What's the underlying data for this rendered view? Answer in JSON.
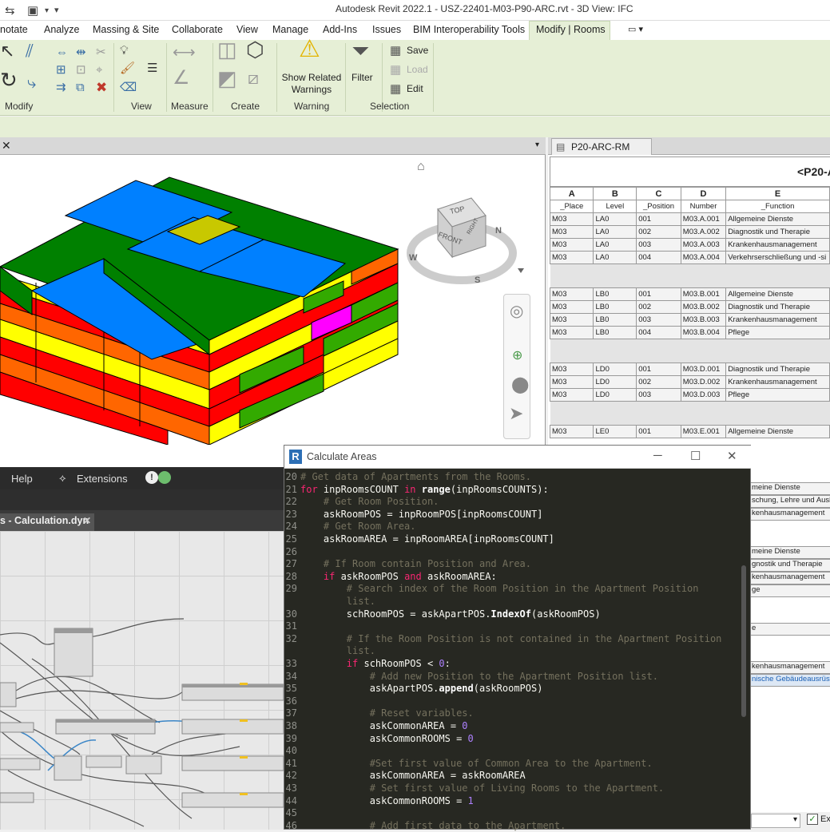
{
  "window": {
    "title": "Autodesk Revit 2022.1 - USZ-22401-M03-P90-ARC.rvt - 3D View: IFC"
  },
  "ribbon_tabs": [
    {
      "label": "notate"
    },
    {
      "label": "Analyze"
    },
    {
      "label": "Massing & Site"
    },
    {
      "label": "Collaborate"
    },
    {
      "label": "View"
    },
    {
      "label": "Manage"
    },
    {
      "label": "Add-Ins"
    },
    {
      "label": "Issues"
    },
    {
      "label": "BIM Interoperability Tools"
    },
    {
      "label": "Modify | Rooms"
    }
  ],
  "ribbon": {
    "panels": {
      "modify": "Modify",
      "view": "View",
      "measure": "Measure",
      "create": "Create",
      "warning": "Warning",
      "selection": "Selection"
    },
    "show_related_warnings": "Show Related\nWarnings",
    "filter": "Filter",
    "save": "Save",
    "load": "Load",
    "edit": "Edit"
  },
  "viewcube": {
    "top": "TOP",
    "front": "FRONT",
    "right": "RIGHT",
    "compass_w": "W",
    "compass_s": "S",
    "compass_n": "N"
  },
  "schedule": {
    "tab_label": "P20-ARC-RM",
    "title": "<P20-A",
    "columns": [
      "A",
      "B",
      "C",
      "D",
      "E"
    ],
    "subheaders": [
      "_Place",
      "Level",
      "_Position",
      "Number",
      "_Function"
    ],
    "groups": [
      [
        [
          "M03",
          "LA0",
          "001",
          "M03.A.001",
          "Allgemeine Dienste"
        ],
        [
          "M03",
          "LA0",
          "002",
          "M03.A.002",
          "Diagnostik und Therapie"
        ],
        [
          "M03",
          "LA0",
          "003",
          "M03.A.003",
          "Krankenhausmanagement"
        ],
        [
          "M03",
          "LA0",
          "004",
          "M03.A.004",
          "Verkehrserschließung und -si"
        ]
      ],
      [
        [
          "M03",
          "LB0",
          "001",
          "M03.B.001",
          "Allgemeine Dienste"
        ],
        [
          "M03",
          "LB0",
          "002",
          "M03.B.002",
          "Diagnostik und Therapie"
        ],
        [
          "M03",
          "LB0",
          "003",
          "M03.B.003",
          "Krankenhausmanagement"
        ],
        [
          "M03",
          "LB0",
          "004",
          "M03.B.004",
          "Pflege"
        ]
      ],
      [
        [
          "M03",
          "LD0",
          "001",
          "M03.D.001",
          "Diagnostik und Therapie"
        ],
        [
          "M03",
          "LD0",
          "002",
          "M03.D.002",
          "Krankenhausmanagement"
        ],
        [
          "M03",
          "LD0",
          "003",
          "M03.D.003",
          "Pflege"
        ]
      ],
      [
        [
          "M03",
          "LE0",
          "001",
          "M03.E.001",
          "Allgemeine Dienste"
        ]
      ]
    ],
    "lower_partial": [
      "meine Dienste",
      "schung, Lehre und Ausbild",
      "kenhausmanagement",
      "meine Dienste",
      "gnostik und Therapie",
      "kenhausmanagement",
      "ge",
      "e",
      "kenhausmanagement",
      "nische Gebäudeausrüst"
    ],
    "status_label": "Ex"
  },
  "dynamo": {
    "menu_help": "Help",
    "menu_extensions": "Extensions",
    "file_tab": "s - Calculation.dyn",
    "tab_close": "✕"
  },
  "code_window": {
    "title": "Calculate Areas",
    "logo": "R",
    "lines": [
      {
        "n": "20",
        "html": "<span class='cm'># Get data of Apartments from the Rooms.</span>"
      },
      {
        "n": "21",
        "html": "<span class='kw'>for</span> inpRoomsCOUNT <span class='kw'>in</span> <span class='fn'>range</span>(inpRoomsCOUNTS):"
      },
      {
        "n": "22",
        "html": "    <span class='cm'># Get Room Position.</span>"
      },
      {
        "n": "23",
        "html": "    askRoomPOS = inpRoomPOS[inpRoomsCOUNT]"
      },
      {
        "n": "24",
        "html": "    <span class='cm'># Get Room Area.</span>"
      },
      {
        "n": "25",
        "html": "    askRoomAREA = inpRoomAREA[inpRoomsCOUNT]"
      },
      {
        "n": "26",
        "html": ""
      },
      {
        "n": "27",
        "html": "    <span class='cm'># If Room contain Position and Area.</span>"
      },
      {
        "n": "28",
        "html": "    <span class='kw'>if</span> askRoomPOS <span class='kw'>and</span> askRoomAREA:"
      },
      {
        "n": "29",
        "html": "        <span class='cm'># Search index of the Room Position in the Apartment Position</span>"
      },
      {
        "n": "",
        "html": "        <span class='cm'>list.</span>"
      },
      {
        "n": "30",
        "html": "        schRoomPOS = askApartPOS.<span class='fn'>IndexOf</span>(askRoomPOS)"
      },
      {
        "n": "31",
        "html": ""
      },
      {
        "n": "32",
        "html": "        <span class='cm'># If the Room Position is not contained in the Apartment Position</span>"
      },
      {
        "n": "",
        "html": "        <span class='cm'>list.</span>"
      },
      {
        "n": "33",
        "html": "        <span class='kw'>if</span> schRoomPOS &lt; <span class='nm'>0</span>:"
      },
      {
        "n": "34",
        "html": "            <span class='cm'># Add new Position to the Apartment Position list.</span>"
      },
      {
        "n": "35",
        "html": "            askApartPOS.<span class='fn'>append</span>(askRoomPOS)"
      },
      {
        "n": "36",
        "html": ""
      },
      {
        "n": "37",
        "html": "            <span class='cm'># Reset variables.</span>"
      },
      {
        "n": "38",
        "html": "            askCommonAREA = <span class='nm'>0</span>"
      },
      {
        "n": "39",
        "html": "            askCommonROOMS = <span class='nm'>0</span>"
      },
      {
        "n": "40",
        "html": ""
      },
      {
        "n": "41",
        "html": "            <span class='cm'>#Set first value of Common Area to the Apartment.</span>"
      },
      {
        "n": "42",
        "html": "            askCommonAREA = askRoomAREA"
      },
      {
        "n": "43",
        "html": "            <span class='cm'># Set first value of Living Rooms to the Apartment.</span>"
      },
      {
        "n": "44",
        "html": "            askCommonROOMS = <span class='nm'>1</span>"
      },
      {
        "n": "45",
        "html": ""
      },
      {
        "n": "46",
        "html": "            <span class='cm'># Add first data to the Apartment.</span>"
      }
    ]
  }
}
